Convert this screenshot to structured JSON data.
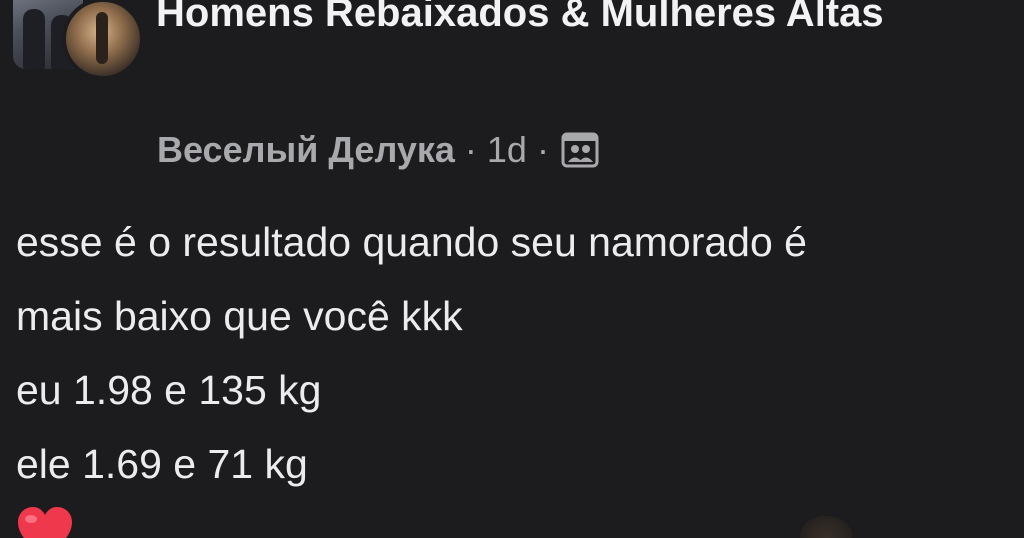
{
  "post": {
    "group_name": "Homens Rebaixados & Mulheres Altas",
    "author": "Веселый Делука",
    "separator": "·",
    "time_ago": "1d",
    "audience_icon": "group-members-icon",
    "body_lines": [
      "esse é o resultado quando seu namorado é",
      "mais baixo que você kkk",
      "eu 1.98 e 135 kg",
      "ele 1.69 e 71 kg"
    ],
    "reaction_icon": "heart-emoji-icon"
  },
  "colors": {
    "background": "#1c1c1e",
    "primary_text": "#ececee",
    "secondary_text": "#a8a9ad",
    "heart": "#f0384c"
  }
}
